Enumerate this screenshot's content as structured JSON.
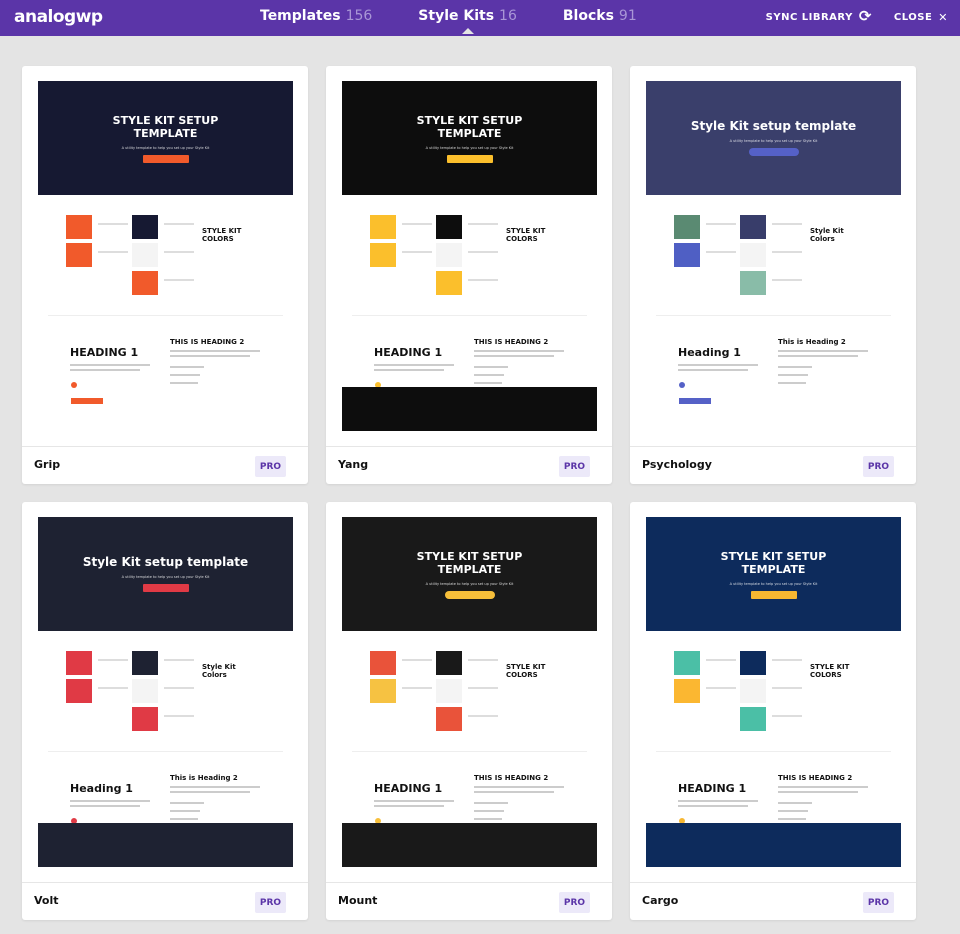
{
  "header": {
    "logo": "analogwp",
    "tabs": [
      {
        "label": "Templates",
        "count": "156"
      },
      {
        "label": "Style Kits",
        "count": "16",
        "active": true
      },
      {
        "label": "Blocks",
        "count": "91"
      }
    ],
    "sync_label": "SYNC LIBRARY",
    "close_label": "CLOSE"
  },
  "kits": [
    {
      "name": "Grip",
      "badge": "PRO",
      "hero": "#161932",
      "accent": "#f15a2b",
      "btn_text": "#fff",
      "title": "STYLE KIT SETUP TEMPLATE",
      "subtitle": "A utility template to help you set up your Style Kit",
      "colors_heading": "STYLE KIT COLORS",
      "h1": "HEADING 1",
      "h2": "THIS IS HEADING 2",
      "swatches": [
        "#f15a2b",
        "#f15a2b",
        "#161932",
        "#f4f4f4",
        "#f15a2b"
      ],
      "band": null
    },
    {
      "name": "Yang",
      "badge": "PRO",
      "hero": "#0d0d0d",
      "accent": "#fbbf2c",
      "btn_text": "#111",
      "title": "STYLE KIT SETUP TEMPLATE",
      "subtitle": "A utility template to help you set up your Style Kit",
      "colors_heading": "STYLE KIT COLORS",
      "h1": "HEADING 1",
      "h2": "THIS IS HEADING 2",
      "swatches": [
        "#fbbf2c",
        "#fbbf2c",
        "#0d0d0d",
        "#f4f4f4",
        "#fbbf2c"
      ],
      "band": "#0d0d0d"
    },
    {
      "name": "Psychology",
      "badge": "PRO",
      "hero": "#3a3f6b",
      "accent": "#5561c7",
      "btn_text": "#fff",
      "title": "Style Kit setup template",
      "subtitle": "A utility template to help you set up your Style Kit",
      "colors_heading": "Style Kit Colors",
      "h1": "Heading 1",
      "h2": "This is Heading 2",
      "swatches": [
        "#5a8a72",
        "#4f5fc4",
        "#383d6a",
        "#f4f4f4",
        "#89bca8"
      ],
      "band": null,
      "pill": true
    },
    {
      "name": "Volt",
      "badge": "PRO",
      "hero": "#1e2232",
      "accent": "#e03a45",
      "btn_text": "#fff",
      "title": "Style Kit setup template",
      "subtitle": "A utility template to help you set up your Style Kit",
      "colors_heading": "Style Kit Colors",
      "h1": "Heading 1",
      "h2": "This is Heading 2",
      "swatches": [
        "#e03a45",
        "#e03a45",
        "#1e2232",
        "#f4f4f4",
        "#e03a45"
      ],
      "band": "#1e2232"
    },
    {
      "name": "Mount",
      "badge": "PRO",
      "hero": "#191919",
      "accent": "#f7bf3a",
      "btn_text": "#111",
      "title": "STYLE KIT SETUP TEMPLATE",
      "subtitle": "A utility template to help you set up your Style Kit",
      "colors_heading": "STYLE KIT COLORS",
      "h1": "HEADING 1",
      "h2": "THIS IS HEADING 2",
      "swatches": [
        "#e9533a",
        "#f6c242",
        "#191919",
        "#f4f4f4",
        "#e9533a"
      ],
      "band": "#191919",
      "pill": true
    },
    {
      "name": "Cargo",
      "badge": "PRO",
      "hero": "#0d2b5c",
      "accent": "#f7b731",
      "btn_text": "#111",
      "title": "STYLE KIT SETUP TEMPLATE",
      "subtitle": "A utility template to help you set up your Style Kit",
      "colors_heading": "STYLE KIT COLORS",
      "h1": "HEADING 1",
      "h2": "THIS IS HEADING 2",
      "swatches": [
        "#4bbfa6",
        "#fbb731",
        "#0d2b5c",
        "#f4f4f4",
        "#4bbfa6"
      ],
      "band": "#0d2b5c"
    }
  ]
}
